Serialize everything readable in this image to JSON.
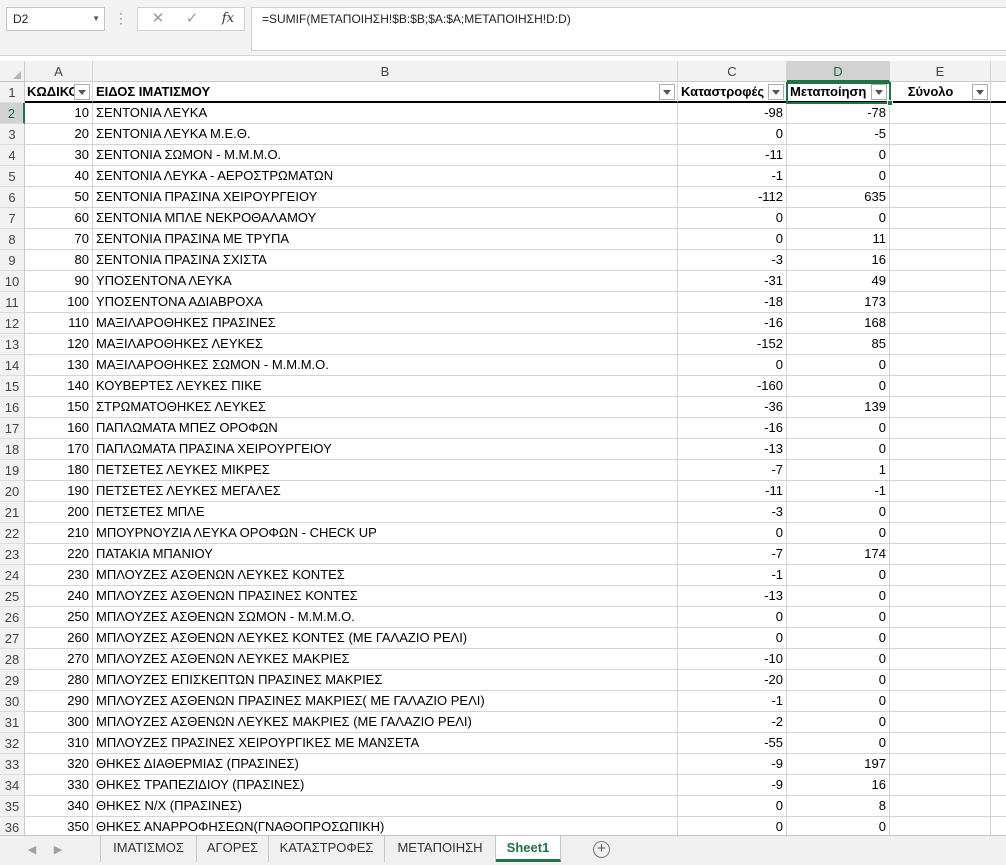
{
  "name_box": "D2",
  "formula": "=SUMIF(ΜΕΤΑΠΟΙΗΣΗ!$B:$B;$A:$A;ΜΕΤΑΠΟΙΗΣΗ!D:D)",
  "columns": [
    "A",
    "B",
    "C",
    "D",
    "E"
  ],
  "headers": {
    "code": "ΚΩΔΙΚΟ",
    "item": "ΕΙΔΟΣ ΙΜΑΤΙΣΜΟΥ",
    "catastrophes": "Καταστροφές",
    "processing": "Μεταποίηση",
    "total": "Σύνολο"
  },
  "rows": [
    {
      "n": "2",
      "a": "10",
      "b": "ΣΕΝΤΟΝΙΑ ΛΕΥΚΑ",
      "c": "-98",
      "d": "-78"
    },
    {
      "n": "3",
      "a": "20",
      "b": "ΣΕΝΤΟΝΙΑ ΛΕΥΚΑ Μ.Ε.Θ.",
      "c": "0",
      "d": "-5"
    },
    {
      "n": "4",
      "a": "30",
      "b": "ΣΕΝΤΟΝΙΑ ΣΩΜΟΝ - Μ.Μ.Μ.Ο.",
      "c": "-11",
      "d": "0"
    },
    {
      "n": "5",
      "a": "40",
      "b": "ΣΕΝΤΟΝΙΑ ΛΕΥΚΑ - ΑΕΡΟΣΤΡΩΜΑΤΩΝ",
      "c": "-1",
      "d": "0"
    },
    {
      "n": "6",
      "a": "50",
      "b": "ΣΕΝΤΟΝΙΑ ΠΡΑΣΙΝΑ ΧΕΙΡΟΥΡΓΕΙΟΥ",
      "c": "-112",
      "d": "635"
    },
    {
      "n": "7",
      "a": "60",
      "b": "ΣΕΝΤΟΝΙΑ ΜΠΛΕ ΝΕΚΡΟΘΑΛΑΜΟΥ",
      "c": "0",
      "d": "0"
    },
    {
      "n": "8",
      "a": "70",
      "b": "ΣΕΝΤΟΝΙΑ ΠΡΑΣΙΝΑ ΜΕ ΤΡΥΠΑ",
      "c": "0",
      "d": "11"
    },
    {
      "n": "9",
      "a": "80",
      "b": "ΣΕΝΤΟΝΙΑ ΠΡΑΣΙΝΑ ΣΧΙΣΤΑ",
      "c": "-3",
      "d": "16"
    },
    {
      "n": "10",
      "a": "90",
      "b": "ΥΠΟΣΕΝΤΟΝΑ ΛΕΥΚΑ",
      "c": "-31",
      "d": "49"
    },
    {
      "n": "11",
      "a": "100",
      "b": "ΥΠΟΣΕΝΤΟΝΑ ΑΔΙΑΒΡΟΧΑ",
      "c": "-18",
      "d": "173"
    },
    {
      "n": "12",
      "a": "110",
      "b": "ΜΑΞΙΛΑΡΟΘΗΚΕΣ ΠΡΑΣΙΝΕΣ",
      "c": "-16",
      "d": "168"
    },
    {
      "n": "13",
      "a": "120",
      "b": "ΜΑΞΙΛΑΡΟΘΗΚΕΣ ΛΕΥΚΕΣ",
      "c": "-152",
      "d": "85"
    },
    {
      "n": "14",
      "a": "130",
      "b": "ΜΑΞΙΛΑΡΟΘΗΚΕΣ ΣΩΜΟΝ - Μ.Μ.Μ.Ο.",
      "c": "0",
      "d": "0"
    },
    {
      "n": "15",
      "a": "140",
      "b": "ΚΟΥΒΕΡΤΕΣ ΛΕΥΚΕΣ ΠΙΚΕ",
      "c": "-160",
      "d": "0"
    },
    {
      "n": "16",
      "a": "150",
      "b": "ΣΤΡΩΜΑΤΟΘΗΚΕΣ ΛΕΥΚΕΣ",
      "c": "-36",
      "d": "139"
    },
    {
      "n": "17",
      "a": "160",
      "b": "ΠΑΠΛΩΜΑΤΑ ΜΠΕΖ ΟΡΟΦΩΝ",
      "c": "-16",
      "d": "0"
    },
    {
      "n": "18",
      "a": "170",
      "b": "ΠΑΠΛΩΜΑΤΑ ΠΡΑΣΙΝΑ ΧΕΙΡΟΥΡΓΕΙΟΥ",
      "c": "-13",
      "d": "0"
    },
    {
      "n": "19",
      "a": "180",
      "b": "ΠΕΤΣΕΤΕΣ ΛΕΥΚΕΣ ΜΙΚΡΕΣ",
      "c": "-7",
      "d": "1"
    },
    {
      "n": "20",
      "a": "190",
      "b": "ΠΕΤΣΕΤΕΣ ΛΕΥΚΕΣ ΜΕΓΑΛΕΣ",
      "c": "-11",
      "d": "-1"
    },
    {
      "n": "21",
      "a": "200",
      "b": "ΠΕΤΣΕΤΕΣ ΜΠΛΕ",
      "c": "-3",
      "d": "0"
    },
    {
      "n": "22",
      "a": "210",
      "b": "ΜΠΟΥΡΝΟΥΖΙΑ ΛΕΥΚΑ ΟΡΟΦΩΝ - CHECK UP",
      "c": "0",
      "d": "0"
    },
    {
      "n": "23",
      "a": "220",
      "b": "ΠΑΤΑΚΙΑ ΜΠΑΝΙΟΥ",
      "c": "-7",
      "d": "174"
    },
    {
      "n": "24",
      "a": "230",
      "b": "ΜΠΛΟΥΖΕΣ ΑΣΘΕΝΩΝ ΛΕΥΚΕΣ ΚΟΝΤΕΣ",
      "c": "-1",
      "d": "0"
    },
    {
      "n": "25",
      "a": "240",
      "b": "ΜΠΛΟΥΖΕΣ ΑΣΘΕΝΩΝ ΠΡΑΣΙΝΕΣ ΚΟΝΤΕΣ",
      "c": "-13",
      "d": "0"
    },
    {
      "n": "26",
      "a": "250",
      "b": "ΜΠΛΟΥΖΕΣ ΑΣΘΕΝΩΝ ΣΩΜΟΝ - Μ.Μ.Μ.Ο.",
      "c": "0",
      "d": "0"
    },
    {
      "n": "27",
      "a": "260",
      "b": "ΜΠΛΟΥΖΕΣ ΑΣΘΕΝΩΝ ΛΕΥΚΕΣ ΚΟΝΤΕΣ (ΜΕ ΓΑΛΑΖΙΟ ΡΕΛΙ)",
      "c": "0",
      "d": "0"
    },
    {
      "n": "28",
      "a": "270",
      "b": "ΜΠΛΟΥΖΕΣ ΑΣΘΕΝΩΝ ΛΕΥΚΕΣ ΜΑΚΡΙΕΣ",
      "c": "-10",
      "d": "0"
    },
    {
      "n": "29",
      "a": "280",
      "b": "ΜΠΛΟΥΖΕΣ ΕΠΙΣΚΕΠΤΩΝ ΠΡΑΣΙΝΕΣ ΜΑΚΡΙΕΣ",
      "c": "-20",
      "d": "0"
    },
    {
      "n": "30",
      "a": "290",
      "b": "ΜΠΛΟΥΖΕΣ ΑΣΘΕΝΩΝ ΠΡΑΣΙΝΕΣ ΜΑΚΡΙΕΣ( ΜΕ ΓΑΛΑΖΙΟ ΡΕΛΙ)",
      "c": "-1",
      "d": "0"
    },
    {
      "n": "31",
      "a": "300",
      "b": "ΜΠΛΟΥΖΕΣ ΑΣΘΕΝΩΝ ΛΕΥΚΕΣ ΜΑΚΡΙΕΣ (ΜΕ ΓΑΛΑΖΙΟ ΡΕΛΙ)",
      "c": "-2",
      "d": "0"
    },
    {
      "n": "32",
      "a": "310",
      "b": "ΜΠΛΟΥΖΕΣ ΠΡΑΣΙΝΕΣ ΧΕΙΡΟΥΡΓΙΚΕΣ ΜΕ ΜΑΝΣΕΤΑ",
      "c": "-55",
      "d": "0"
    },
    {
      "n": "33",
      "a": "320",
      "b": "ΘΗΚΕΣ ΔΙΑΘΕΡΜΙΑΣ (ΠΡΑΣΙΝΕΣ)",
      "c": "-9",
      "d": "197"
    },
    {
      "n": "34",
      "a": "330",
      "b": "ΘΗΚΕΣ ΤΡΑΠΕΖΙΔΙΟΥ (ΠΡΑΣΙΝΕΣ)",
      "c": "-9",
      "d": "16"
    },
    {
      "n": "35",
      "a": "340",
      "b": "ΘΗΚΕΣ Ν/Χ (ΠΡΑΣΙΝΕΣ)",
      "c": "0",
      "d": "8"
    },
    {
      "n": "36",
      "a": "350",
      "b": "ΘΗΚΕΣ ΑΝΑΡΡΟΦΗΣΕΩΝ(ΓΝΑΘΟΠΡΟΣΩΠΙΚΗ)",
      "c": "0",
      "d": "0"
    }
  ],
  "sheet_tabs": [
    "ΙΜΑΤΙΣΜΟΣ",
    "ΑΓΟΡΕΣ",
    "ΚΑΤΑΣΤΡΟΦΕΣ",
    "ΜΕΤΑΠΟΙΗΣΗ",
    "Sheet1"
  ],
  "active_tab": "Sheet1",
  "accent_color": "#217346"
}
